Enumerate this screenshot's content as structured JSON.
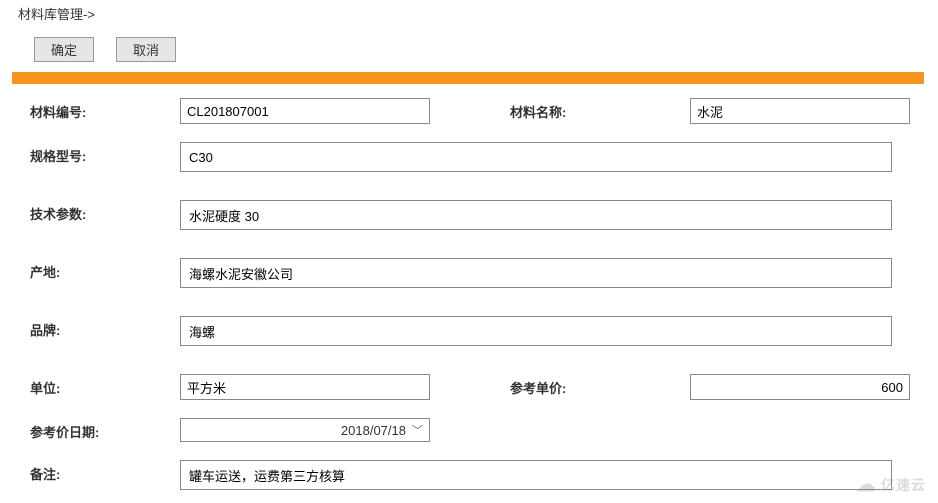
{
  "breadcrumb": "材料库管理->",
  "buttons": {
    "confirm": "确定",
    "cancel": "取消"
  },
  "form": {
    "material_code": {
      "label": "材料编号:",
      "value": "CL201807001"
    },
    "material_name": {
      "label": "材料名称:",
      "value": "水泥"
    },
    "spec_model": {
      "label": "规格型号:",
      "value": "C30"
    },
    "tech_params": {
      "label": "技术参数:",
      "value": "水泥硬度 30"
    },
    "origin": {
      "label": "产地:",
      "value": "海螺水泥安徽公司"
    },
    "brand": {
      "label": "品牌:",
      "value": "海螺"
    },
    "unit": {
      "label": "单位:",
      "value": "平方米"
    },
    "ref_price": {
      "label": "参考单价:",
      "value": "600"
    },
    "ref_date": {
      "label": "参考价日期:",
      "value": "2018/07/18"
    },
    "remark": {
      "label": "备注:",
      "value": "罐车运送，运费第三方核算"
    }
  },
  "watermark": "亿速云"
}
